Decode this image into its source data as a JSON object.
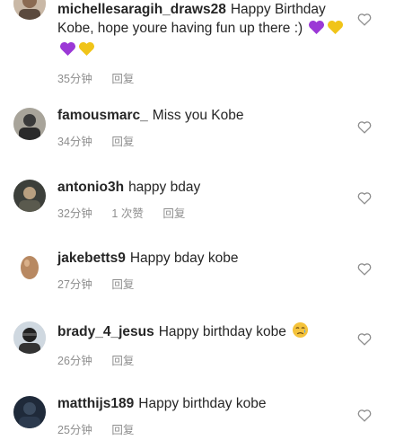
{
  "comments": [
    {
      "username": "michellesaragih_draws28",
      "text": "Happy Birthday Kobe, hope youre having fun up there :)",
      "emojis": [
        "purple-heart",
        "yellow-heart",
        "purple-heart",
        "yellow-heart"
      ],
      "time": "35分钟",
      "reply": "回复"
    },
    {
      "username": "famousmarc_",
      "text": "Miss you Kobe",
      "time": "34分钟",
      "reply": "回复"
    },
    {
      "username": "antonio3h",
      "text": "happy bday",
      "time": "32分钟",
      "likes": "1 次赞",
      "reply": "回复"
    },
    {
      "username": "jakebetts9",
      "text": "Happy bday kobe",
      "time": "27分钟",
      "reply": "回复"
    },
    {
      "username": "brady_4_jesus",
      "text": "Happy birthday kobe",
      "emojis": [
        "crying-face"
      ],
      "time": "26分钟",
      "reply": "回复"
    },
    {
      "username": "matthijs189",
      "text": "Happy birthday kobe",
      "time": "25分钟",
      "reply": "回复"
    }
  ],
  "colors": {
    "text": "#262626",
    "meta": "#8e8e8e",
    "purple_heart": "#9b38d6",
    "yellow_heart": "#f0c419"
  },
  "icons": [
    "heart-outline-icon"
  ]
}
